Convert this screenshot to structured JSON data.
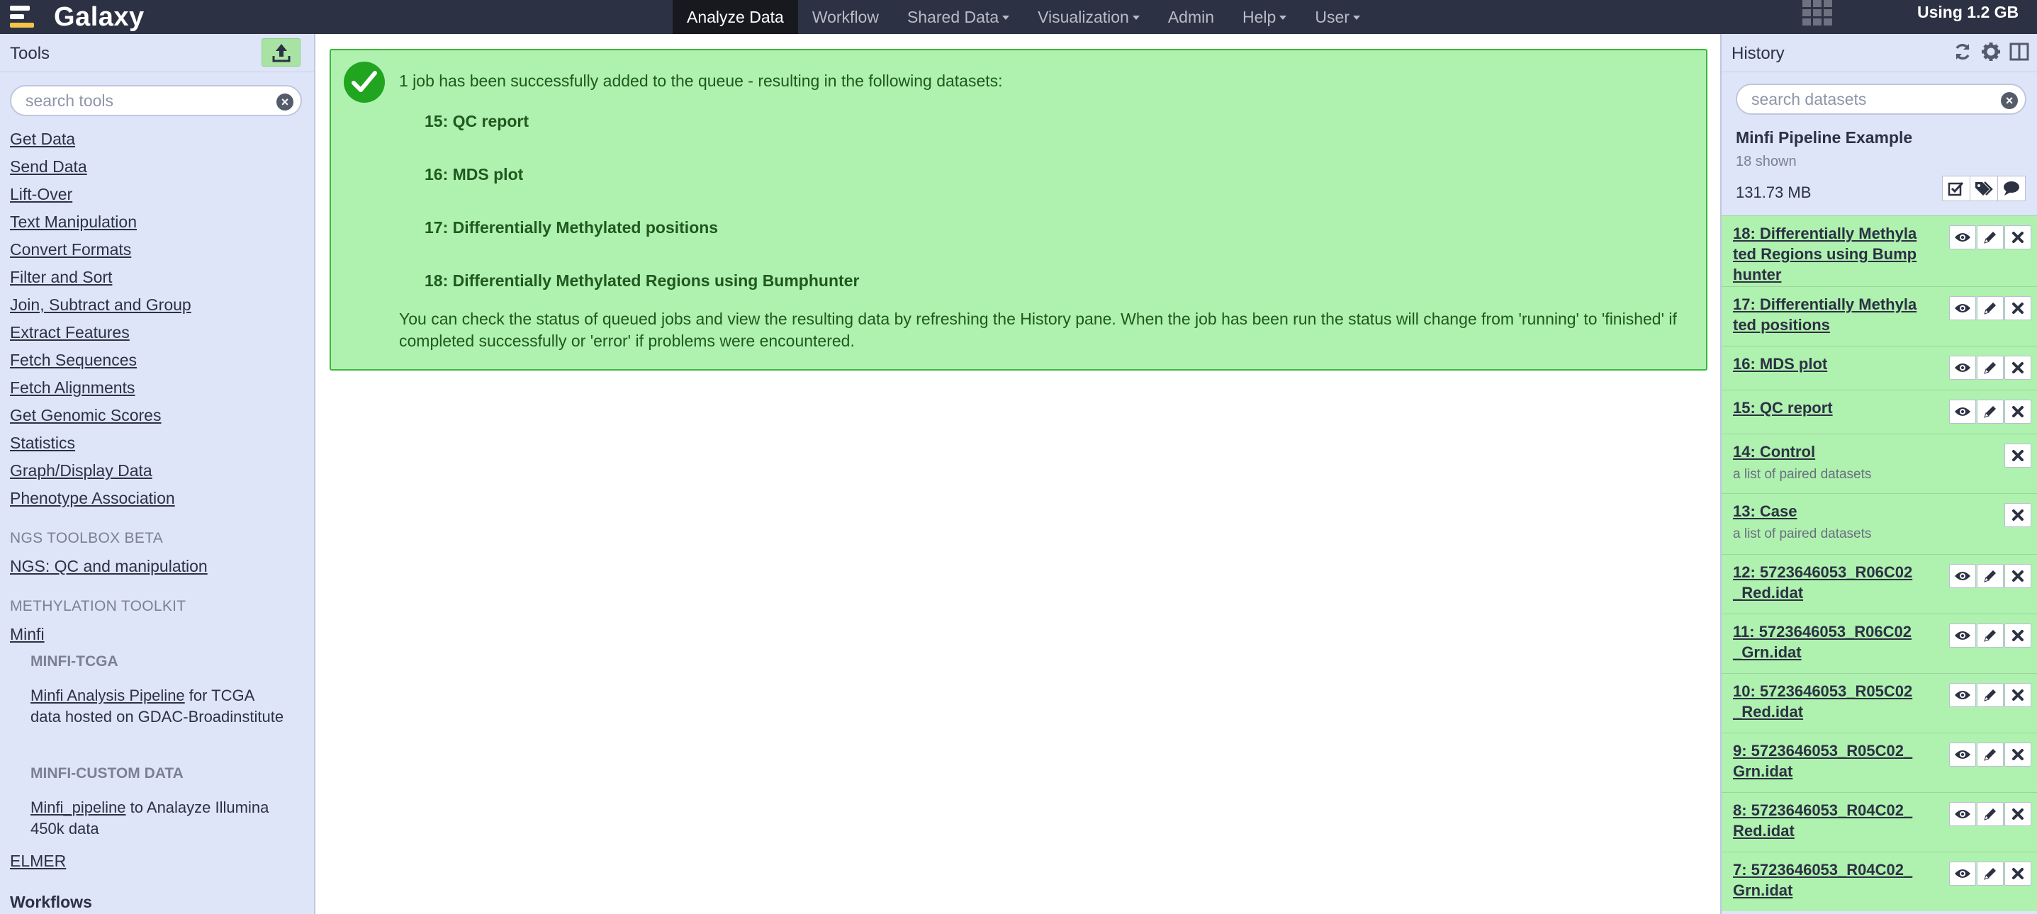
{
  "masthead": {
    "brand": "Galaxy",
    "nav": [
      {
        "label": "Analyze Data",
        "active": true,
        "dropdown": false
      },
      {
        "label": "Workflow",
        "active": false,
        "dropdown": false
      },
      {
        "label": "Shared Data",
        "active": false,
        "dropdown": true
      },
      {
        "label": "Visualization",
        "active": false,
        "dropdown": true
      },
      {
        "label": "Admin",
        "active": false,
        "dropdown": false
      },
      {
        "label": "Help",
        "active": false,
        "dropdown": true
      },
      {
        "label": "User",
        "active": false,
        "dropdown": true
      }
    ],
    "apps_icon": "grid-icon",
    "quota": "Using 1.2 GB"
  },
  "tools": {
    "title": "Tools",
    "upload_icon": "upload-icon",
    "search_placeholder": "search tools",
    "items": [
      "Get Data",
      "Send Data",
      "Lift-Over",
      "Text Manipulation",
      "Convert Formats",
      "Filter and Sort",
      "Join, Subtract and Group",
      "Extract Features",
      "Fetch Sequences",
      "Fetch Alignments",
      "Get Genomic Scores",
      "Statistics",
      "Graph/Display Data",
      "Phenotype Association"
    ],
    "ngs_label": "NGS TOOLBOX BETA",
    "ngs_link": "NGS: QC and manipulation",
    "meth_label": "METHYLATION TOOLKIT",
    "minfi_link": "Minfi",
    "tcga_label": "MINFI-TCGA",
    "tcga_tool": "Minfi Analysis Pipeline",
    "tcga_desc": " for TCGA data hosted on GDAC-Broadinstitute",
    "custom_label": "MINFI-CUSTOM DATA",
    "custom_tool": "Minfi_pipeline",
    "custom_desc": " to Analayze Illumina 450k data",
    "elmer_link": "ELMER",
    "workflows_label": "Workflows"
  },
  "message": {
    "icon": "check-circle-icon",
    "intro": "1 job has been successfully added to the queue - resulting in the following datasets:",
    "datasets": [
      "15: QC report",
      "16: MDS plot",
      "17: Differentially Methylated positions",
      "18: Differentially Methylated Regions using Bumphunter"
    ],
    "note": "You can check the status of queued jobs and view the resulting data by refreshing the History pane. When the job has been run the status will change from 'running' to 'finished' if completed successfully or 'error' if problems were encountered."
  },
  "history": {
    "title": "History",
    "search_placeholder": "search datasets",
    "name": "Minfi Pipeline Example",
    "shown": "18 shown",
    "size": "131.73 MB",
    "datasets": [
      {
        "title": "18: Differentially Methylated Regions using Bumphunter",
        "sub": "",
        "actions": [
          "eye",
          "pencil",
          "delete"
        ]
      },
      {
        "title": "17: Differentially Methylated positions",
        "sub": "",
        "actions": [
          "eye",
          "pencil",
          "delete"
        ]
      },
      {
        "title": "16: MDS plot",
        "sub": "",
        "actions": [
          "eye",
          "pencil",
          "delete"
        ]
      },
      {
        "title": "15: QC report",
        "sub": "",
        "actions": [
          "eye",
          "pencil",
          "delete"
        ]
      },
      {
        "title": "14: Control",
        "sub": "a list of paired datasets",
        "actions": [
          "delete"
        ]
      },
      {
        "title": "13: Case",
        "sub": "a list of paired datasets",
        "actions": [
          "delete"
        ]
      },
      {
        "title": "12: 5723646053_R06C02_Red.idat",
        "sub": "",
        "actions": [
          "eye",
          "pencil",
          "delete"
        ]
      },
      {
        "title": "11: 5723646053_R06C02_Grn.idat",
        "sub": "",
        "actions": [
          "eye",
          "pencil",
          "delete"
        ]
      },
      {
        "title": "10: 5723646053_R05C02_Red.idat",
        "sub": "",
        "actions": [
          "eye",
          "pencil",
          "delete"
        ]
      },
      {
        "title": "9: 5723646053_R05C02_Grn.idat",
        "sub": "",
        "actions": [
          "eye",
          "pencil",
          "delete"
        ]
      },
      {
        "title": "8: 5723646053_R04C02_Red.idat",
        "sub": "",
        "actions": [
          "eye",
          "pencil",
          "delete"
        ]
      },
      {
        "title": "7: 5723646053_R04C02_Grn.idat",
        "sub": "",
        "actions": [
          "eye",
          "pencil",
          "delete"
        ]
      }
    ]
  }
}
